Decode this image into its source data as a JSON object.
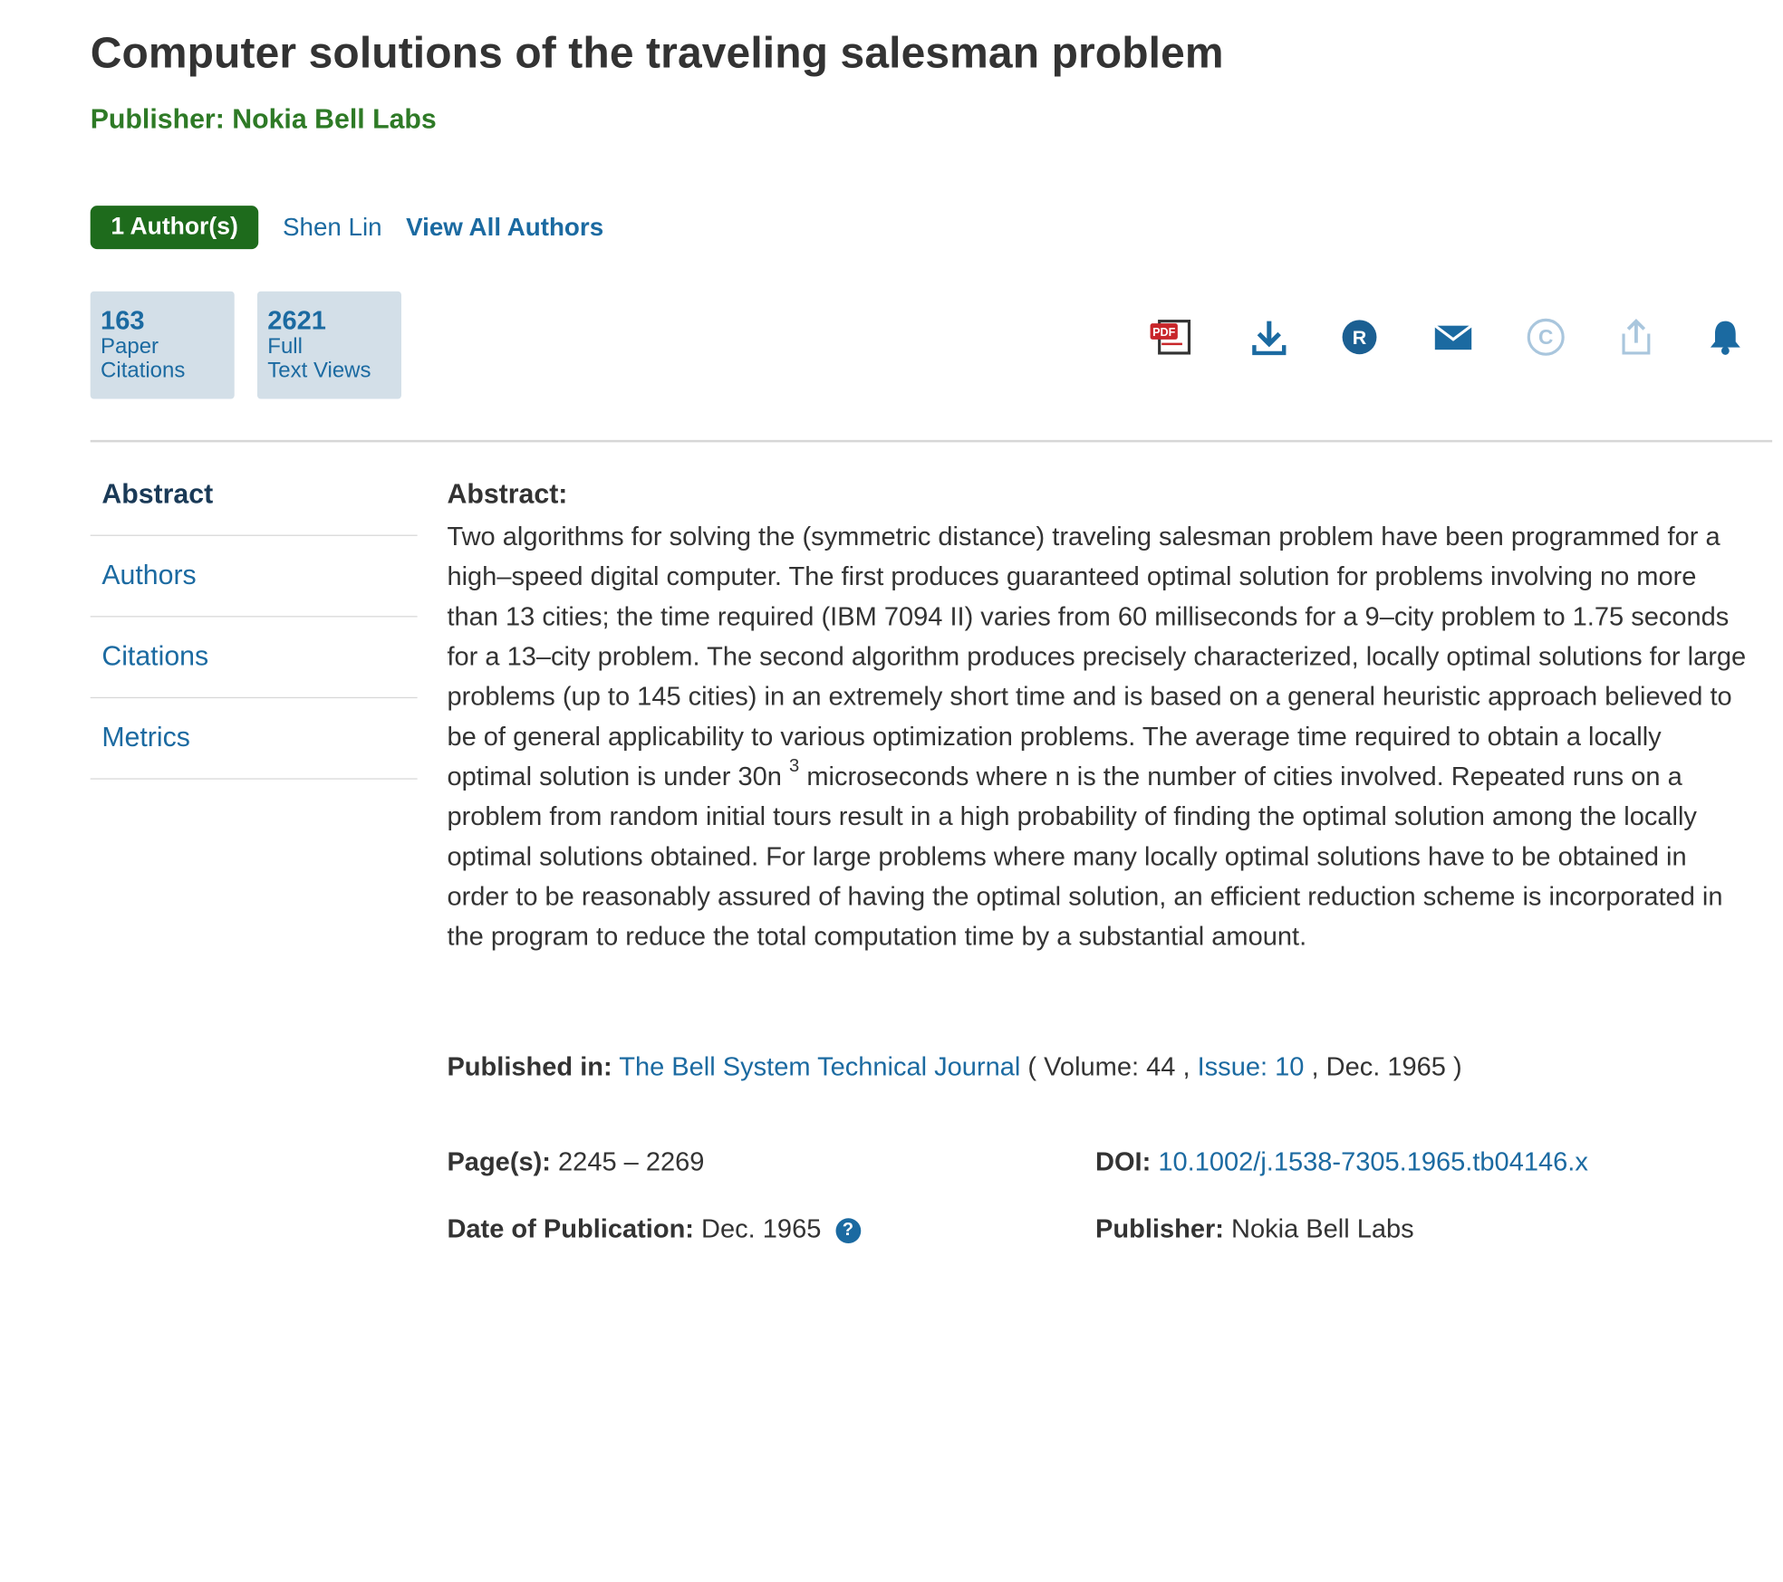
{
  "article": {
    "title": "Computer solutions of the traveling salesman problem",
    "publisher_line": "Publisher: Nokia Bell Labs"
  },
  "authors": {
    "count_label": "1 Author(s)",
    "names": [
      "Shen Lin"
    ],
    "view_all_label": "View All Authors"
  },
  "metrics": [
    {
      "value": "163",
      "label_line1": "Paper",
      "label_line2": "Citations"
    },
    {
      "value": "2621",
      "label_line1": "Full",
      "label_line2": "Text Views"
    }
  ],
  "action_icons": [
    "pdf-icon",
    "download-icon",
    "rights-icon",
    "email-icon",
    "copyright-icon",
    "share-icon",
    "alert-bell-icon"
  ],
  "colors": {
    "brand_green": "#1e6b1c",
    "publisher_green": "#2e7a26",
    "link_blue": "#1b6aa1",
    "metric_bg": "#d3dfe8",
    "pdf_red": "#c8262a"
  },
  "side_nav": [
    {
      "label": "Abstract",
      "active": true
    },
    {
      "label": "Authors",
      "active": false
    },
    {
      "label": "Citations",
      "active": false
    },
    {
      "label": "Metrics",
      "active": false
    }
  ],
  "abstract": {
    "heading": "Abstract:",
    "text_before_sup": "Two algorithms for solving the (symmetric distance) traveling salesman problem have been programmed for a high–speed digital computer. The first produces guaranteed optimal solution for problems involving no more than 13 cities; the time required (IBM 7094 II) varies from 60 milliseconds for a 9–city problem to 1.75 seconds for a 13–city problem. The second algorithm produces precisely characterized, locally optimal solutions for large problems (up to 145 cities) in an extremely short time and is based on a general heuristic approach believed to be of general applicability to various optimization problems. The average time required to obtain a locally optimal solution is under 30n ",
    "superscript": "3",
    "text_after_sup": " microseconds where n is the number of cities involved. Repeated runs on a problem from random initial tours result in a high probability of finding the optimal solution among the locally optimal solutions obtained. For large problems where many locally optimal solutions have to be obtained in order to be reasonably assured of having the optimal solution, an efficient reduction scheme is incorporated in the program to reduce the total computation time by a substantial amount."
  },
  "published_in": {
    "label": "Published in:",
    "journal": "The Bell System Technical Journal",
    "open_paren": " ( ",
    "volume": "Volume: 44",
    "sep1": " , ",
    "issue": "Issue: 10",
    "sep2": " , ",
    "date": "Dec. 1965",
    "close_paren": " )"
  },
  "details": {
    "pages_label": "Page(s):",
    "pages_value": "2245 – 2269",
    "doi_label": "DOI:",
    "doi_value": "10.1002/j.1538-7305.1965.tb04146.x",
    "date_label": "Date of Publication:",
    "date_value": "Dec. 1965",
    "help_glyph": "?",
    "publisher_label": "Publisher:",
    "publisher_value": "Nokia Bell Labs"
  }
}
